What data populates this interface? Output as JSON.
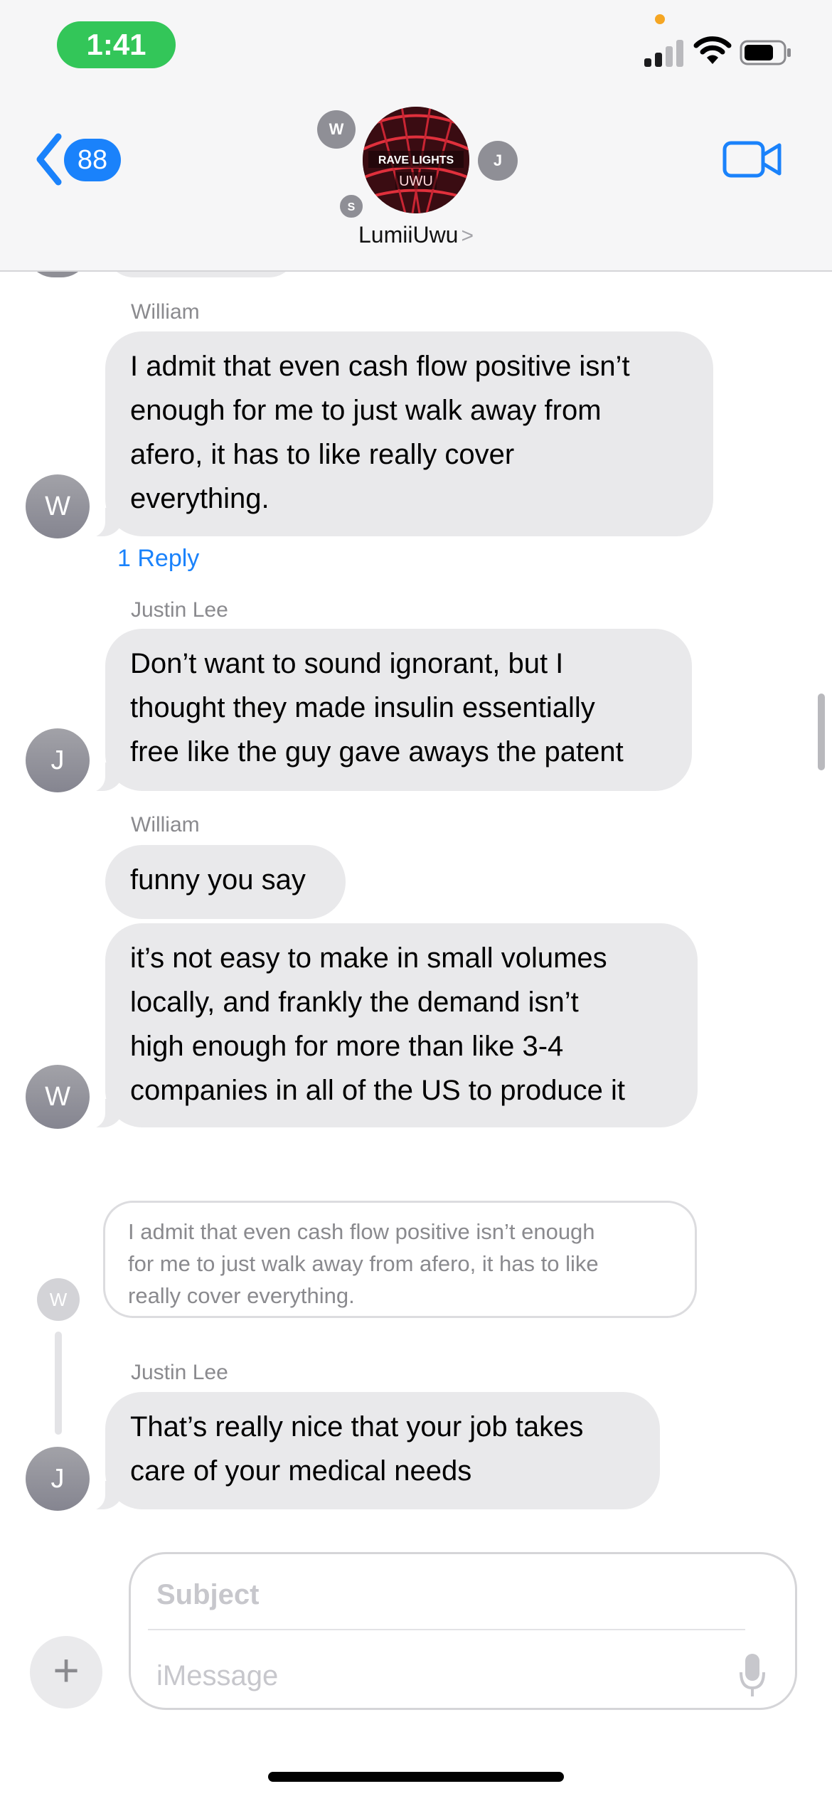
{
  "status_bar": {
    "time": "1:41"
  },
  "header": {
    "back_count": "88",
    "group_name": "LumiiUwu",
    "group_avatar_line1": "RAVE LIGHTS",
    "group_avatar_line2": "UWU",
    "participants": [
      "W",
      "J",
      "S"
    ]
  },
  "messages": [
    {
      "sender": "William",
      "avatar": "W",
      "bubbles": [
        "I admit that even cash flow positive isn’t\nenough for me to just walk away from\nafero, it has to like really cover\neverything."
      ],
      "reply_link": "1 Reply"
    },
    {
      "sender": "Justin Lee",
      "avatar": "J",
      "bubbles": [
        "Don’t want to sound ignorant, but I\nthought they made insulin essentially\nfree like the guy gave aways the patent"
      ]
    },
    {
      "sender": "William",
      "avatar": "W",
      "bubbles": [
        "funny you say",
        "it’s not easy to make in small volumes\nlocally, and frankly the demand isn’t\nhigh enough for more than like 3-4\ncompanies in all of the US to produce it"
      ]
    }
  ],
  "thread_reply": {
    "quoted_avatar": "W",
    "quoted_text": "I admit that even cash flow positive isn’t enough\nfor me to just walk away from afero, it has to like\nreally cover everything.",
    "sender": "Justin Lee",
    "avatar": "J",
    "text": "That’s really nice that your job takes\ncare of your medical needs"
  },
  "composer": {
    "subject_placeholder": "Subject",
    "message_placeholder": "iMessage",
    "plus_label": "+"
  },
  "icons": {
    "back": "chevron-left-icon",
    "video": "video-camera-icon",
    "mic": "microphone-icon",
    "plus": "plus-icon"
  },
  "colors": {
    "accent": "#1a82fb",
    "time_pill": "#33c659",
    "bubble": "#e9e9eb",
    "avatar": "#8f8f96"
  }
}
